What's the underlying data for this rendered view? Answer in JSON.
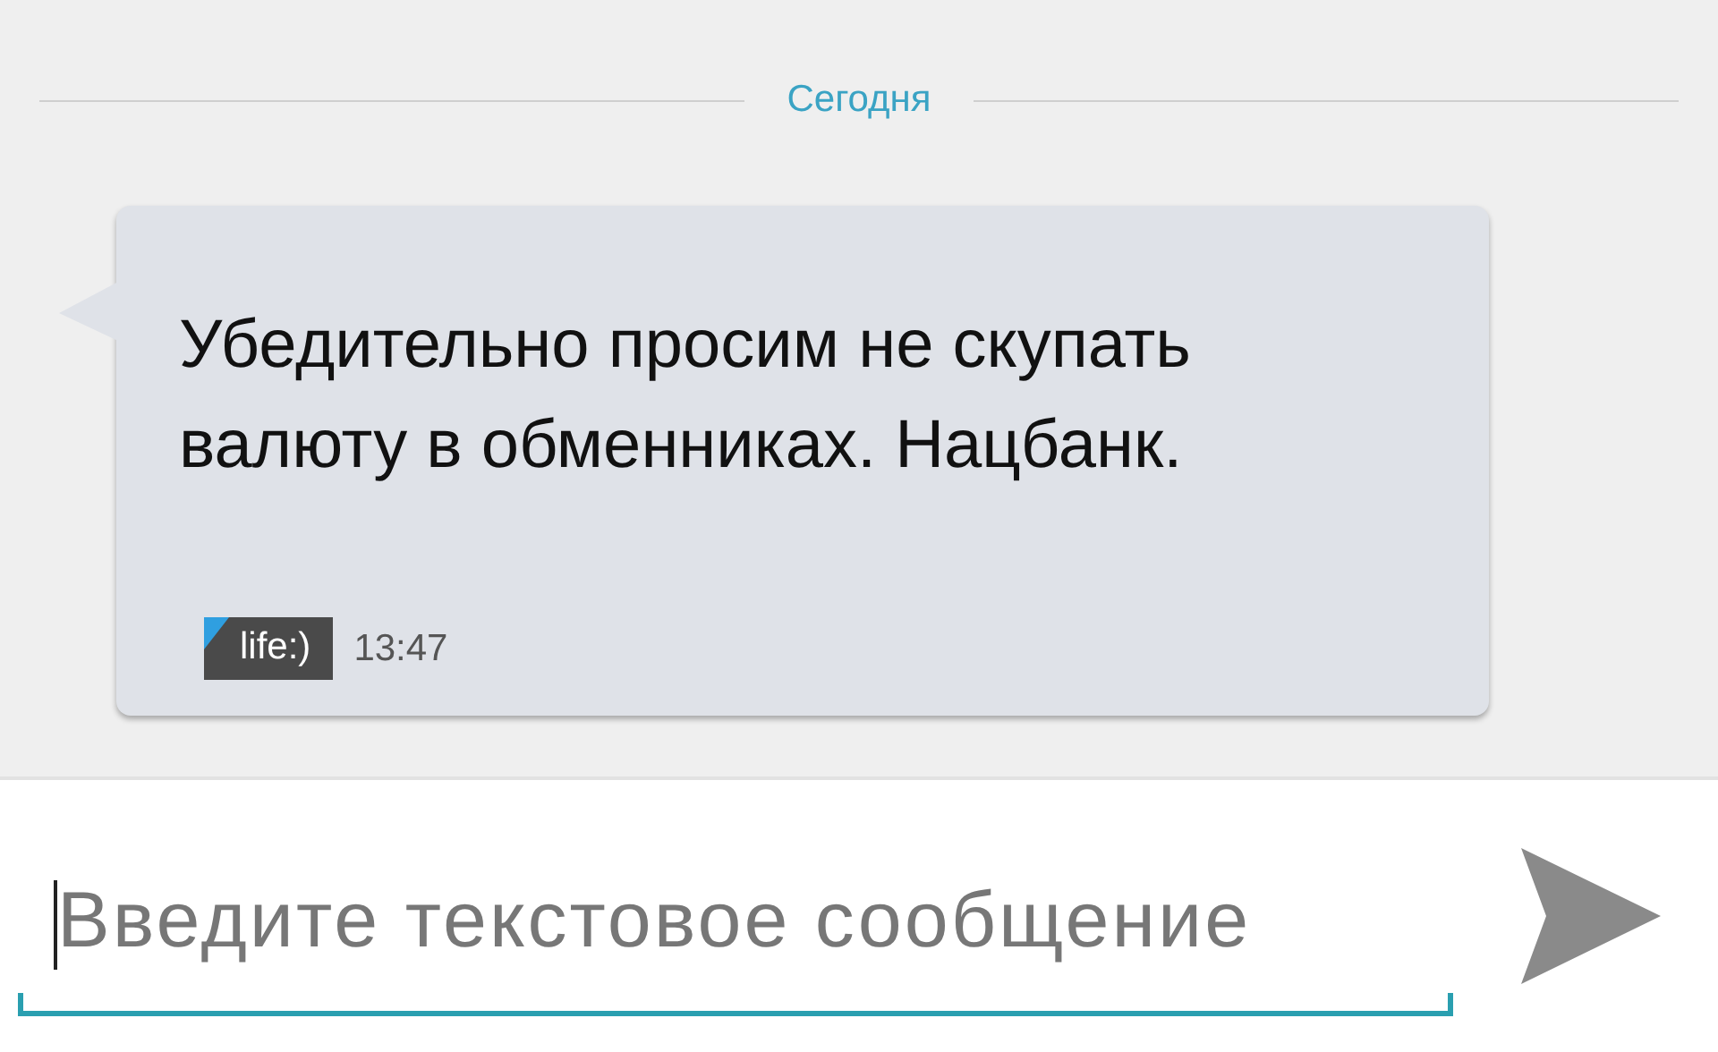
{
  "date_divider": {
    "label": "Сегодня"
  },
  "message": {
    "text": "Убедительно просим не скупать валюту в обменниках. Нацбанк.",
    "sim_label": "life:)",
    "time": "13:47"
  },
  "composer": {
    "placeholder": "Введите текстовое сообщение"
  }
}
